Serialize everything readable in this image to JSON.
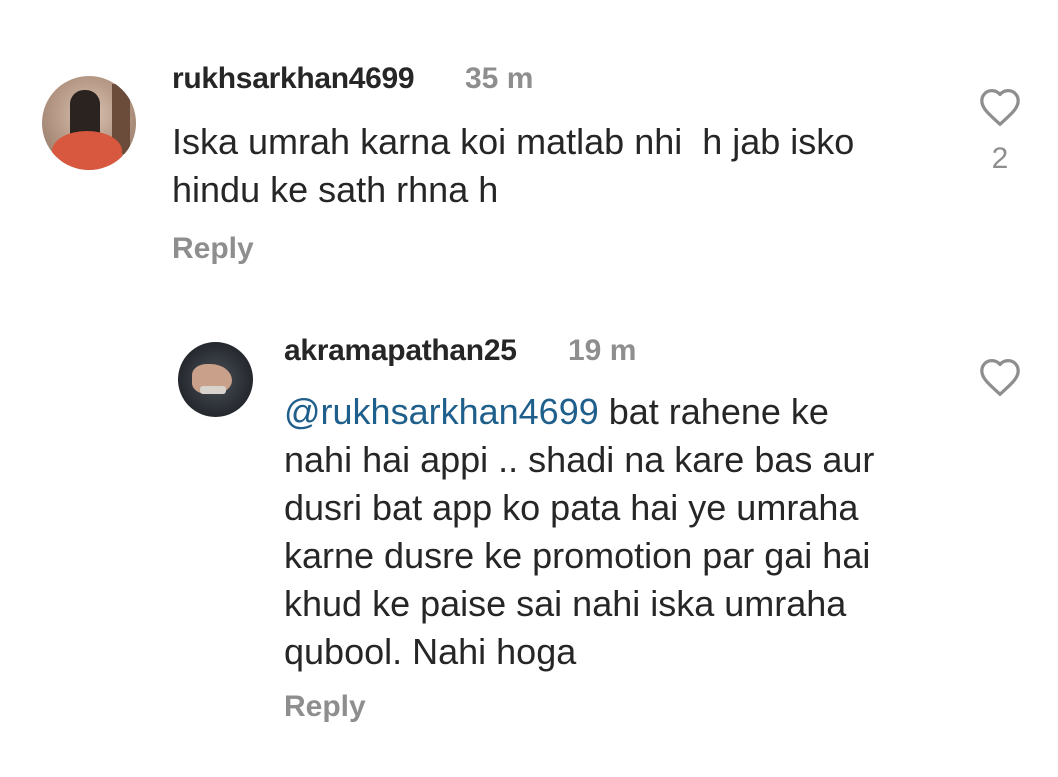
{
  "comments": [
    {
      "username": "rukhsarkhan4699",
      "time": "35 m",
      "text": "Iska umrah karna koi matlab nhi  h jab isko\nhindu ke sath rhna h",
      "reply_label": "Reply",
      "likes": "2"
    },
    {
      "username": "akramapathan25",
      "time": "19 m",
      "mention": "@rukhsarkhan4699",
      "text": " bat rahene ke\nnahi hai appi .. shadi na kare bas aur\ndusri bat app ko pata hai ye umraha\nkarne dusre ke promotion par gai hai\nkhud ke paise sai nahi iska umraha\nqubool. Nahi hoga",
      "reply_label": "Reply"
    }
  ],
  "colors": {
    "text": "#262626",
    "muted": "#8e8e8e",
    "mention": "#1f5f8b"
  },
  "icons": {
    "like": "heart-outline-icon"
  }
}
